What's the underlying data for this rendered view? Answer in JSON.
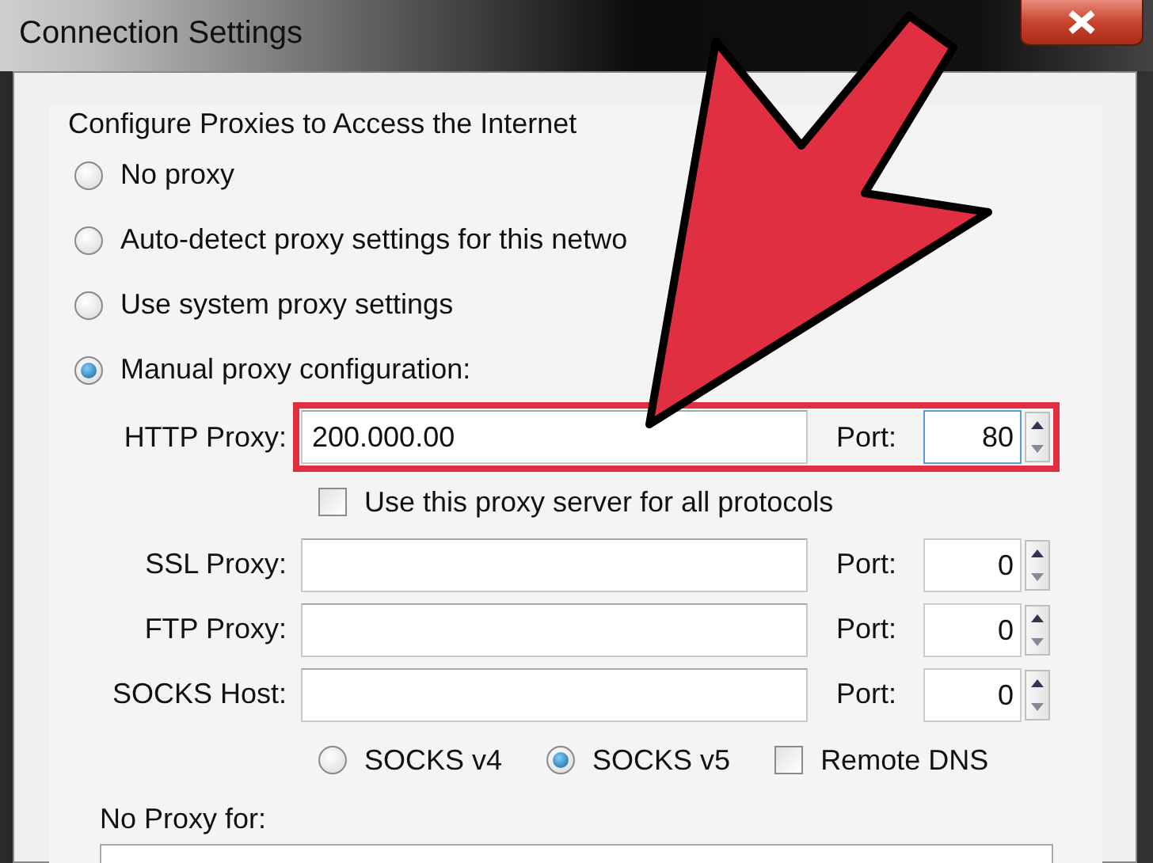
{
  "window": {
    "title": "Connection Settings"
  },
  "group": {
    "title": "Configure Proxies to Access the Internet"
  },
  "proxy_modes": [
    {
      "label": "No proxy",
      "selected": false
    },
    {
      "label": "Auto-detect proxy settings for this netwo",
      "selected": false
    },
    {
      "label": "Use system proxy settings",
      "selected": false
    },
    {
      "label": "Manual proxy configuration:",
      "selected": true
    }
  ],
  "proxies": [
    {
      "label": "HTTP Proxy:",
      "value": "200.000.00",
      "port_label": "Port:",
      "port": "80",
      "highlighted": true,
      "focused": true
    },
    {
      "kind": "share",
      "label": "Use this proxy server for all protocols",
      "checked": false
    },
    {
      "label": "SSL Proxy:",
      "port_label": "Port:",
      "port": "0",
      "highlighted": false,
      "focused": false
    },
    {
      "label": "FTP Proxy:",
      "port_label": "Port:",
      "port": "0",
      "highlighted": false,
      "focused": false
    },
    {
      "label": "SOCKS Host:",
      "port_label": "Port:",
      "port": "0",
      "highlighted": false,
      "focused": false
    }
  ],
  "socks_versions": [
    {
      "label": "SOCKS v4",
      "selected": false
    },
    {
      "label": "SOCKS v5",
      "selected": true
    }
  ],
  "remote_dns": {
    "label": "Remote DNS",
    "checked": false
  },
  "no_proxy": {
    "label": "No Proxy for:"
  }
}
